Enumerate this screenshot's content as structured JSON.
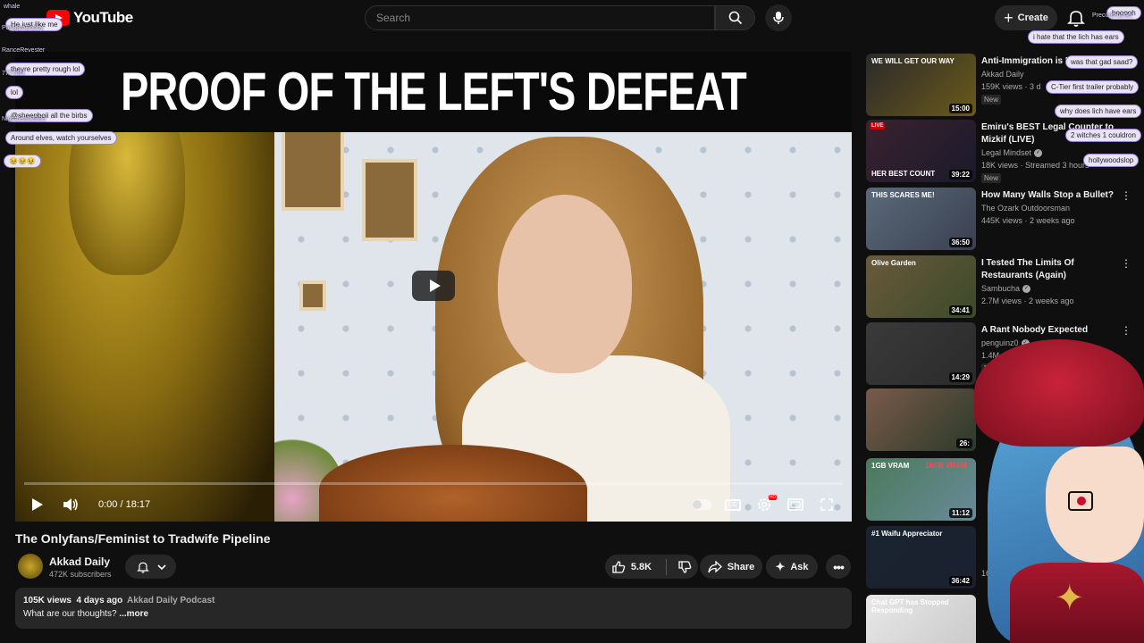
{
  "header": {
    "logo_text": "YouTube",
    "search_placeholder": "Search",
    "create_label": "Create"
  },
  "player": {
    "headline": "PROOF OF THE LEFT'S DEFEAT",
    "time": "0:00 / 18:17",
    "progress": 0
  },
  "video": {
    "title": "The Onlyfans/Feminist to Tradwife Pipeline",
    "channel": "Akkad Daily",
    "subscribers": "472K subscribers",
    "likes": "5.8K",
    "share_label": "Share",
    "ask_label": "Ask",
    "views": "105K views",
    "age": "4 days ago",
    "podcast": "Akkad Daily Podcast",
    "description": "What are our thoughts?",
    "more_label": "...more"
  },
  "recommendations": [
    {
      "title": "Anti-Immigration is L",
      "channel": "Akkad Daily",
      "stats": "159K views · 3 d",
      "new": "New",
      "duration": "15:00",
      "caption": "WE WILL GET OUR WAY",
      "colors": [
        "#2a2a2a",
        "#6b5a1a"
      ]
    },
    {
      "title": "Emiru's BEST Legal Counter to Mizkif (LIVE)",
      "channel": "Legal Mindset",
      "stats": "18K views · Streamed 3 hours",
      "new": "New",
      "duration": "39:22",
      "caption": "HER BEST COUNT",
      "live": "LIVE",
      "colors": [
        "#3a2230",
        "#1a1a2a"
      ]
    },
    {
      "title": "How Many Walls Stop a Bullet?",
      "channel": "The Ozark Outdoorsman",
      "stats": "445K views · 2 weeks ago",
      "duration": "36:50",
      "caption": "THIS SCARES ME!",
      "colors": [
        "#5a6a7a",
        "#3a4050"
      ]
    },
    {
      "title": "I Tested The Limits Of Restaurants (Again)",
      "channel": "Sambucha",
      "stats": "2.7M views · 2 weeks ago",
      "duration": "34:41",
      "caption": "Olive Garden",
      "colors": [
        "#6a5a3a",
        "#3a4a2a"
      ]
    },
    {
      "title": "A Rant Nobody Expected",
      "channel": "penguinz0",
      "stats": "1.4M vie",
      "new": "New",
      "duration": "14:29",
      "colors": [
        "#3a3a3a",
        "#2a2a2a"
      ]
    },
    {
      "title": "",
      "channel": "",
      "stats": "",
      "duration": "26:",
      "colors": [
        "#7a5a4a",
        "#2a3a2a"
      ]
    },
    {
      "title": "",
      "channel": "",
      "stats": "",
      "duration": "11:12",
      "caption": "1GB VRAM",
      "caption2": "16GB VRAM",
      "colors": [
        "#4a7a5a",
        "#6a8a9a"
      ]
    },
    {
      "title": "",
      "channel": "",
      "stats": "165",
      "duration": "36:42",
      "caption": "#1 Waifu Appreciator",
      "colors": [
        "#1a2430",
        "#1a2030"
      ]
    },
    {
      "title": "",
      "channel": "",
      "stats": "",
      "caption": "Chat GPT has Stopped Responding",
      "colors": [
        "#e8e8e8",
        "#c8c8c8"
      ]
    }
  ],
  "chat_overlay": [
    {
      "user": "whale",
      "msg": "He just like me"
    },
    {
      "user": "ParagonBobby",
      "msg": ""
    },
    {
      "user": "RanceRevester",
      "msg": "theyre pretty rough lol"
    },
    {
      "user": "7777dm",
      "msg": "lol"
    },
    {
      "user": "",
      "msg": "@sheepboii all the birbs"
    },
    {
      "user": "Nightbeast3083",
      "msg": "Around elves, watch yourselves"
    },
    {
      "user": "",
      "msg": "🥹🥹🥹"
    },
    {
      "user": "",
      "msg": "i hate that the lich has ears"
    },
    {
      "user": "",
      "msg": "booooh"
    },
    {
      "user": "PrecureHunter",
      "msg": ""
    },
    {
      "user": "",
      "msg": "was that gad saad?"
    },
    {
      "user": "",
      "msg": "C-Tier first trailer probably"
    },
    {
      "user": "",
      "msg": "why does lich have ears"
    },
    {
      "user": "",
      "msg": "2 witches 1 couldron"
    },
    {
      "user": "",
      "msg": "hollywoodslop"
    }
  ]
}
